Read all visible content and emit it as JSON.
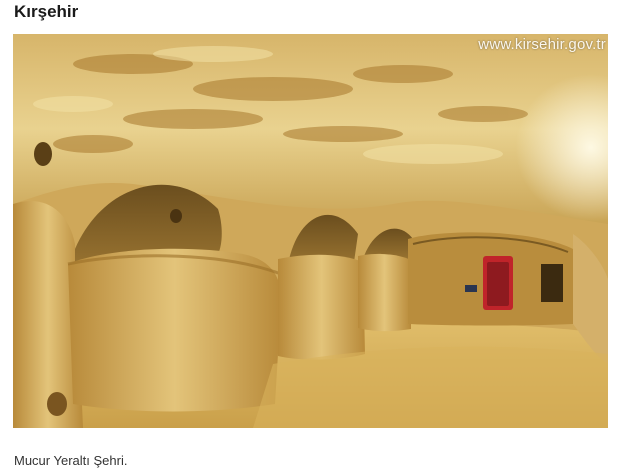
{
  "article": {
    "title": "Kırşehir",
    "caption": "Mucur Yeraltı Şehri."
  },
  "photo": {
    "watermark": "www.kirsehir.gov.tr",
    "subject": "underground-city-tunnel"
  },
  "colors": {
    "background": "#ffffff",
    "title_text": "#1a1a1a",
    "caption_text": "#333333",
    "rock_light": "#e8cf86",
    "rock_dark": "#8a6a2a",
    "door_red": "#c0242a"
  }
}
